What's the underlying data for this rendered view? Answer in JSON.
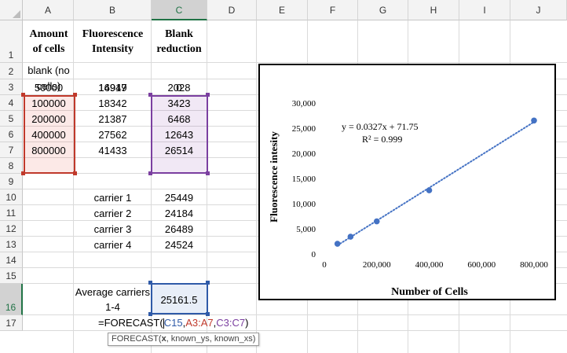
{
  "columns": [
    "A",
    "B",
    "C",
    "D",
    "E",
    "F",
    "G",
    "H",
    "I",
    "J"
  ],
  "active_column": "C",
  "rows": [
    "1",
    "2",
    "3",
    "4",
    "5",
    "6",
    "7",
    "8",
    "9",
    "10",
    "11",
    "12",
    "13",
    "14",
    "15",
    "16",
    "17"
  ],
  "active_row": "16",
  "headers": {
    "a1": "Amount of cells",
    "b1": "Fluorescence Intensity",
    "c1": "Blank reduction"
  },
  "blank": {
    "a": "blank (no cells)",
    "b": "14919",
    "c": "0"
  },
  "table": [
    {
      "cells": "50000",
      "fluor": "16947",
      "reduction": "2028"
    },
    {
      "cells": "100000",
      "fluor": "18342",
      "reduction": "3423"
    },
    {
      "cells": "200000",
      "fluor": "21387",
      "reduction": "6468"
    },
    {
      "cells": "400000",
      "fluor": "27562",
      "reduction": "12643"
    },
    {
      "cells": "800000",
      "fluor": "41433",
      "reduction": "26514"
    }
  ],
  "carriers": [
    {
      "label": "carrier 1",
      "value": "25449"
    },
    {
      "label": "carrier 2",
      "value": "24184"
    },
    {
      "label": "carrier 3",
      "value": "26489"
    },
    {
      "label": "carrier 4",
      "value": "24524"
    }
  ],
  "average": {
    "label": "Average carriers 1-4",
    "value": "25161.5"
  },
  "formula": {
    "prefix": "=FORECAST(",
    "arg1": "C15",
    "sep1": ",",
    "arg2": "A3:A7",
    "sep2": ",",
    "arg3": "C3:C7",
    "suffix": ")"
  },
  "tooltip": {
    "prefix": "FORECAST(",
    "bold": "x",
    "rest": ", known_ys, known_xs)"
  },
  "colors": {
    "range_a": "#c0392b",
    "range_c": "#7b3fa0",
    "range_c15": "#2f5aa8",
    "point": "#4472c4",
    "active_header": "#217346"
  },
  "chart_data": {
    "type": "scatter",
    "equation": "y = 0.0327x + 71.75",
    "r2": "R² = 0.999",
    "xlabel": "Number of Cells",
    "ylabel": "Fluorescence intesity",
    "xlim": [
      0,
      800000
    ],
    "ylim": [
      0,
      30000
    ],
    "x_ticks": [
      "0",
      "200,000",
      "400,000",
      "600,000",
      "800,000"
    ],
    "y_ticks": [
      "0",
      "5,000",
      "10,000",
      "15,000",
      "20,000",
      "25,000",
      "30,000"
    ],
    "points": [
      {
        "x": 50000,
        "y": 2028
      },
      {
        "x": 100000,
        "y": 3423
      },
      {
        "x": 200000,
        "y": 6468
      },
      {
        "x": 400000,
        "y": 12643
      },
      {
        "x": 800000,
        "y": 26514
      }
    ],
    "trendline": {
      "slope": 0.0327,
      "intercept": 71.75,
      "style": "dotted"
    },
    "grid": false
  }
}
